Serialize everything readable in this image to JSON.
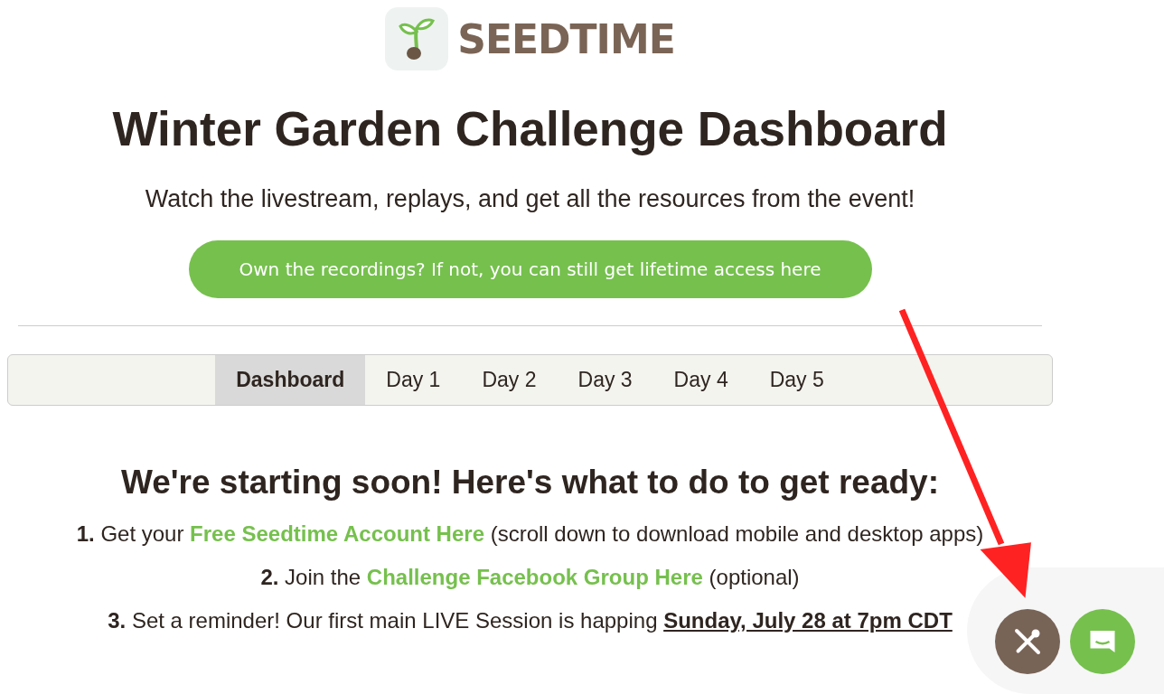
{
  "logo": {
    "text": "SEEDTIME"
  },
  "title": "Winter Garden Challenge Dashboard",
  "subtitle": "Watch the livestream, replays, and get all the resources from the event!",
  "cta_button": "Own the recordings? If not, you can still get lifetime access here",
  "tabs": [
    {
      "label": "Dashboard",
      "selected": true
    },
    {
      "label": "Day 1",
      "selected": false
    },
    {
      "label": "Day 2",
      "selected": false
    },
    {
      "label": "Day 3",
      "selected": false
    },
    {
      "label": "Day 4",
      "selected": false
    },
    {
      "label": "Day 5",
      "selected": false
    }
  ],
  "heading": "We're starting soon! Here's what to do to get ready:",
  "steps": [
    {
      "number": "1.",
      "before": "Get your ",
      "emphasis": {
        "kind": "link",
        "text": "Free Seedtime Account Here"
      },
      "after": " (scroll down to download mobile and desktop apps)"
    },
    {
      "number": "2.",
      "before": "Join the ",
      "emphasis": {
        "kind": "link",
        "text": "Challenge Facebook Group Here"
      },
      "after": " (optional)"
    },
    {
      "number": "3.",
      "before": "Set a reminder! Our first main LIVE Session is happing ",
      "emphasis": {
        "kind": "date",
        "text": "Sunday, July 28 at 7pm CDT"
      }
    }
  ]
}
